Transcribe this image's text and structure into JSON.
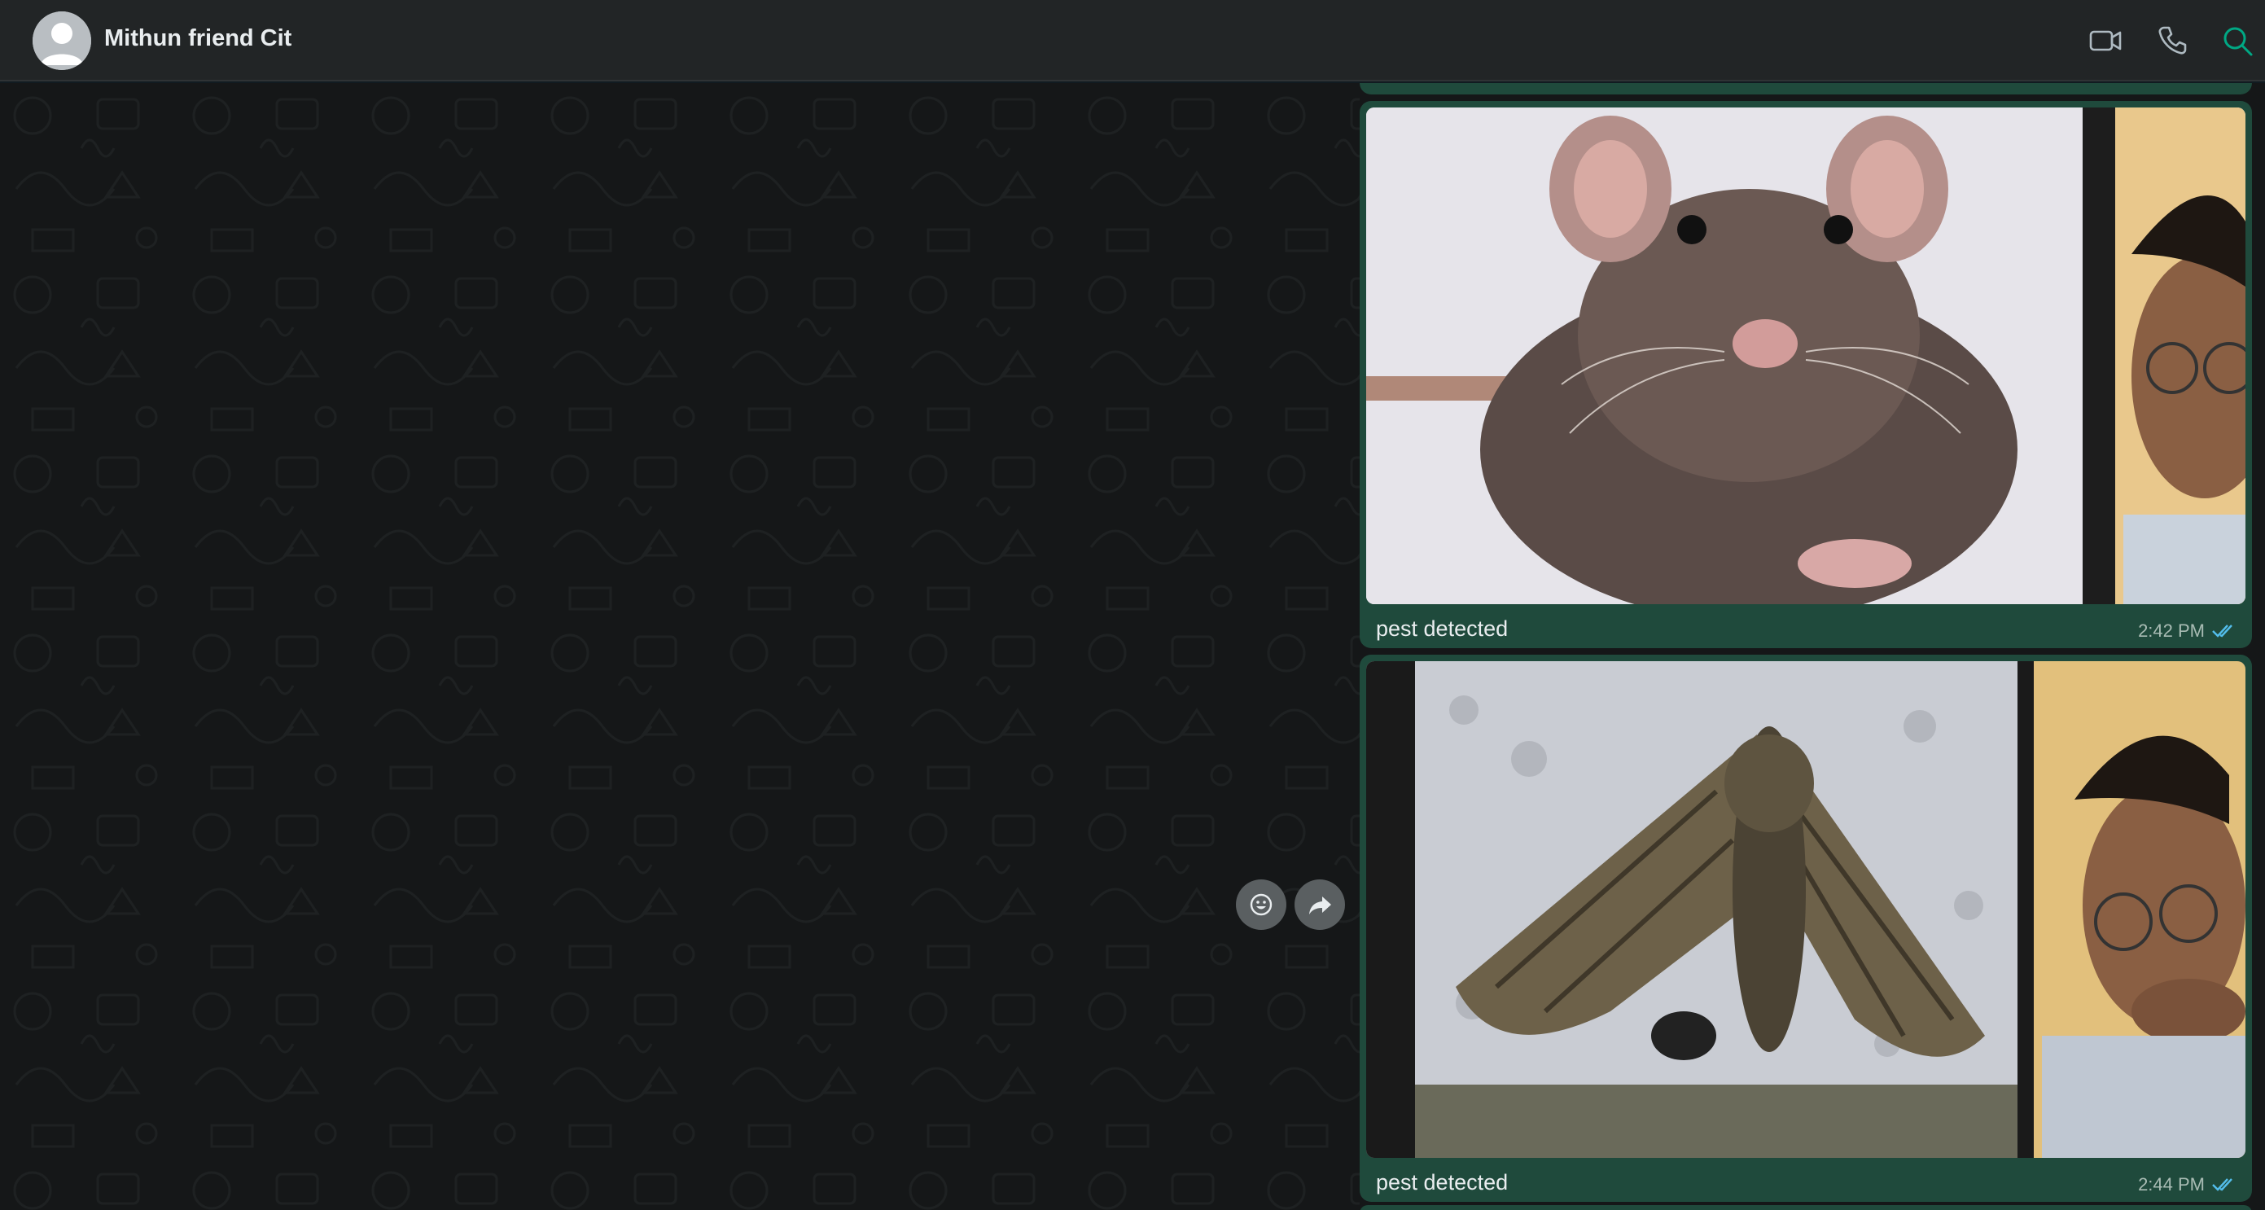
{
  "header": {
    "contact_name": "Mithun friend Cit",
    "icons": [
      "avatar-placeholder",
      "video-call-icon",
      "voice-call-icon",
      "search-icon"
    ]
  },
  "messages": [
    {
      "type": "image",
      "image_desc_icon": "rat-photo",
      "caption": "pest detected",
      "time": "2:42 PM",
      "status": "read"
    },
    {
      "type": "image",
      "image_desc_icon": "moth-photo",
      "caption": "pest detected",
      "time": "2:44 PM",
      "status": "read"
    }
  ],
  "hover_actions": {
    "icons": [
      "emoji-react-icon",
      "forward-icon"
    ]
  },
  "colors": {
    "header_bg": "#222526",
    "chat_bg": "#151718",
    "outgoing_bubble": "#1f4a3c",
    "accent": "#53bdeb",
    "search_accent": "#00a884"
  }
}
